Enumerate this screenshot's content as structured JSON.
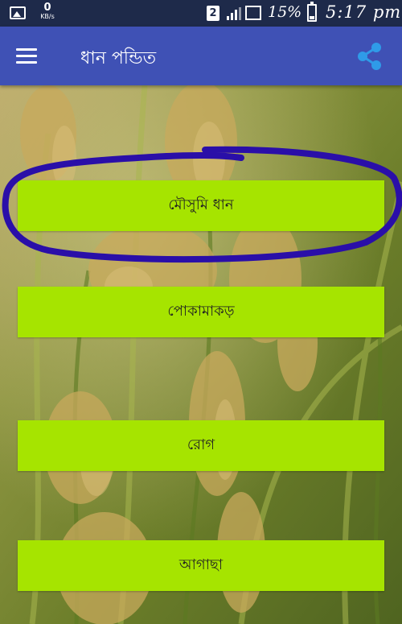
{
  "status_bar": {
    "network_speed": "0",
    "network_unit": "KB/s",
    "sim_slot": "2",
    "battery_percent": "15%",
    "time": "5:17 pm",
    "icons": [
      "gallery-icon",
      "signal-icon",
      "wifi-icon",
      "battery-icon"
    ]
  },
  "app_bar": {
    "title": "ধান পন্ডিত",
    "color": "#3f51b5",
    "icons": [
      "hamburger-menu-icon",
      "share-icon"
    ]
  },
  "menu": {
    "button_color": "#a6e400",
    "items": [
      {
        "label": "মৌসুমি ধান"
      },
      {
        "label": "পোকামাকড়"
      },
      {
        "label": "রোগ"
      },
      {
        "label": "আগাছা"
      }
    ]
  },
  "annotation": {
    "highlight_color": "#2a0fa8",
    "highlighted_item": "মৌসুমি ধান"
  }
}
